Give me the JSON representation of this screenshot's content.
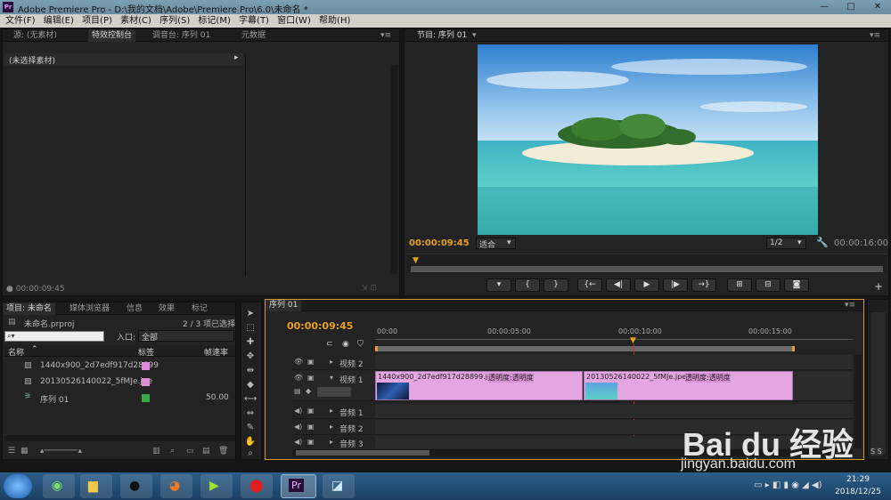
{
  "app": {
    "title": "Adobe Premiere Pro - D:\\我的文档\\Adobe\\Premiere Pro\\6.0\\未命名 *",
    "logo": "Pr"
  },
  "menu": [
    "文件(F)",
    "编辑(E)",
    "项目(P)",
    "素材(C)",
    "序列(S)",
    "标记(M)",
    "字幕(T)",
    "窗口(W)",
    "帮助(H)"
  ],
  "source_panel": {
    "tabs": [
      "源: (无素材)",
      "特效控制台",
      "调音台: 序列 01",
      "元数据"
    ],
    "active_tab": "特效控制台",
    "no_clip_label": "(未选择素材)",
    "timecode": "00:00:09:45"
  },
  "program_panel": {
    "tab": "节目: 序列 01",
    "timecode": "00:00:09:45",
    "fit_label": "适合",
    "resolution": "1/2",
    "duration": "00:00:16:00",
    "buttons": [
      "marker-icon",
      "in-icon",
      "out-icon",
      "goto-in-icon",
      "step-back-icon",
      "play-icon",
      "step-forward-icon",
      "goto-out-icon",
      "lift-icon",
      "extract-icon",
      "export-frame-icon"
    ],
    "button_glyphs": [
      "▾",
      "{",
      "}",
      "{←",
      "◀|",
      "▶",
      "|▶",
      "→}",
      "⊞",
      "⊟",
      "◙"
    ]
  },
  "project_panel": {
    "tabs": [
      "项目: 未命名",
      "媒体浏览器",
      "信息",
      "效果",
      "标记"
    ],
    "project_file": "未命名.prproj",
    "selection_count": "2 / 3 项已选择",
    "entry_label": "入口:",
    "entry_value": "全部",
    "columns": [
      "名称",
      "标签",
      "帧速率"
    ],
    "items": [
      {
        "name": "1440x900_2d7edf917d28899",
        "color": "#e08ad8",
        "rate": ""
      },
      {
        "name": "20130526140022_5fMJe.jpe",
        "color": "#e08ad8",
        "rate": ""
      },
      {
        "name": "序列 01",
        "color": "#3aa84a",
        "rate": "50.00"
      }
    ]
  },
  "timeline": {
    "tab": "序列 01",
    "timecode": "00:00:09:45",
    "ruler": [
      "00:00",
      "00:00:05:00",
      "00:00:10:00",
      "00:00:15:00"
    ],
    "tracks": [
      {
        "name": "视频 2"
      },
      {
        "name": "视频 1"
      },
      {
        "name": "音频 1"
      },
      {
        "name": "音频 2"
      },
      {
        "name": "音频 3"
      }
    ],
    "clips": [
      {
        "name": "1440x900_2d7edf917d28899.jpg",
        "fx": "透明度:透明度"
      },
      {
        "name": "20130526140022_5fMJe.jpeg",
        "fx": "透明度:透明度"
      }
    ]
  },
  "taskbar": {
    "time": "21:29",
    "date": "2018/12/25"
  },
  "watermark": {
    "brand": "Bai du 经验",
    "url": "jingyan.baidu.com"
  }
}
